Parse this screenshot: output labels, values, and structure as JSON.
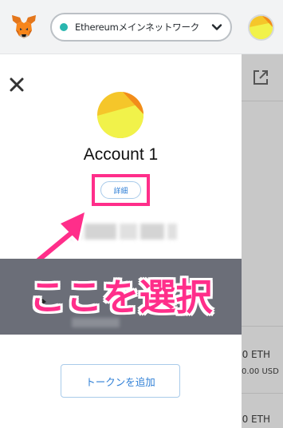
{
  "header": {
    "network_label": "Ethereumメインネットワーク",
    "network_dot_color": "#29b6af"
  },
  "account": {
    "name": "Account 1",
    "details_label": "詳細"
  },
  "annotation": {
    "caption": "ここを選択",
    "accent_color": "#ff2e8a"
  },
  "actions": {
    "add_token_label": "トークンを追加"
  },
  "background_balance": {
    "eth_label": "0 ETH",
    "usd_label": "0.00 USD",
    "eth_label_2": "0 ETH"
  }
}
